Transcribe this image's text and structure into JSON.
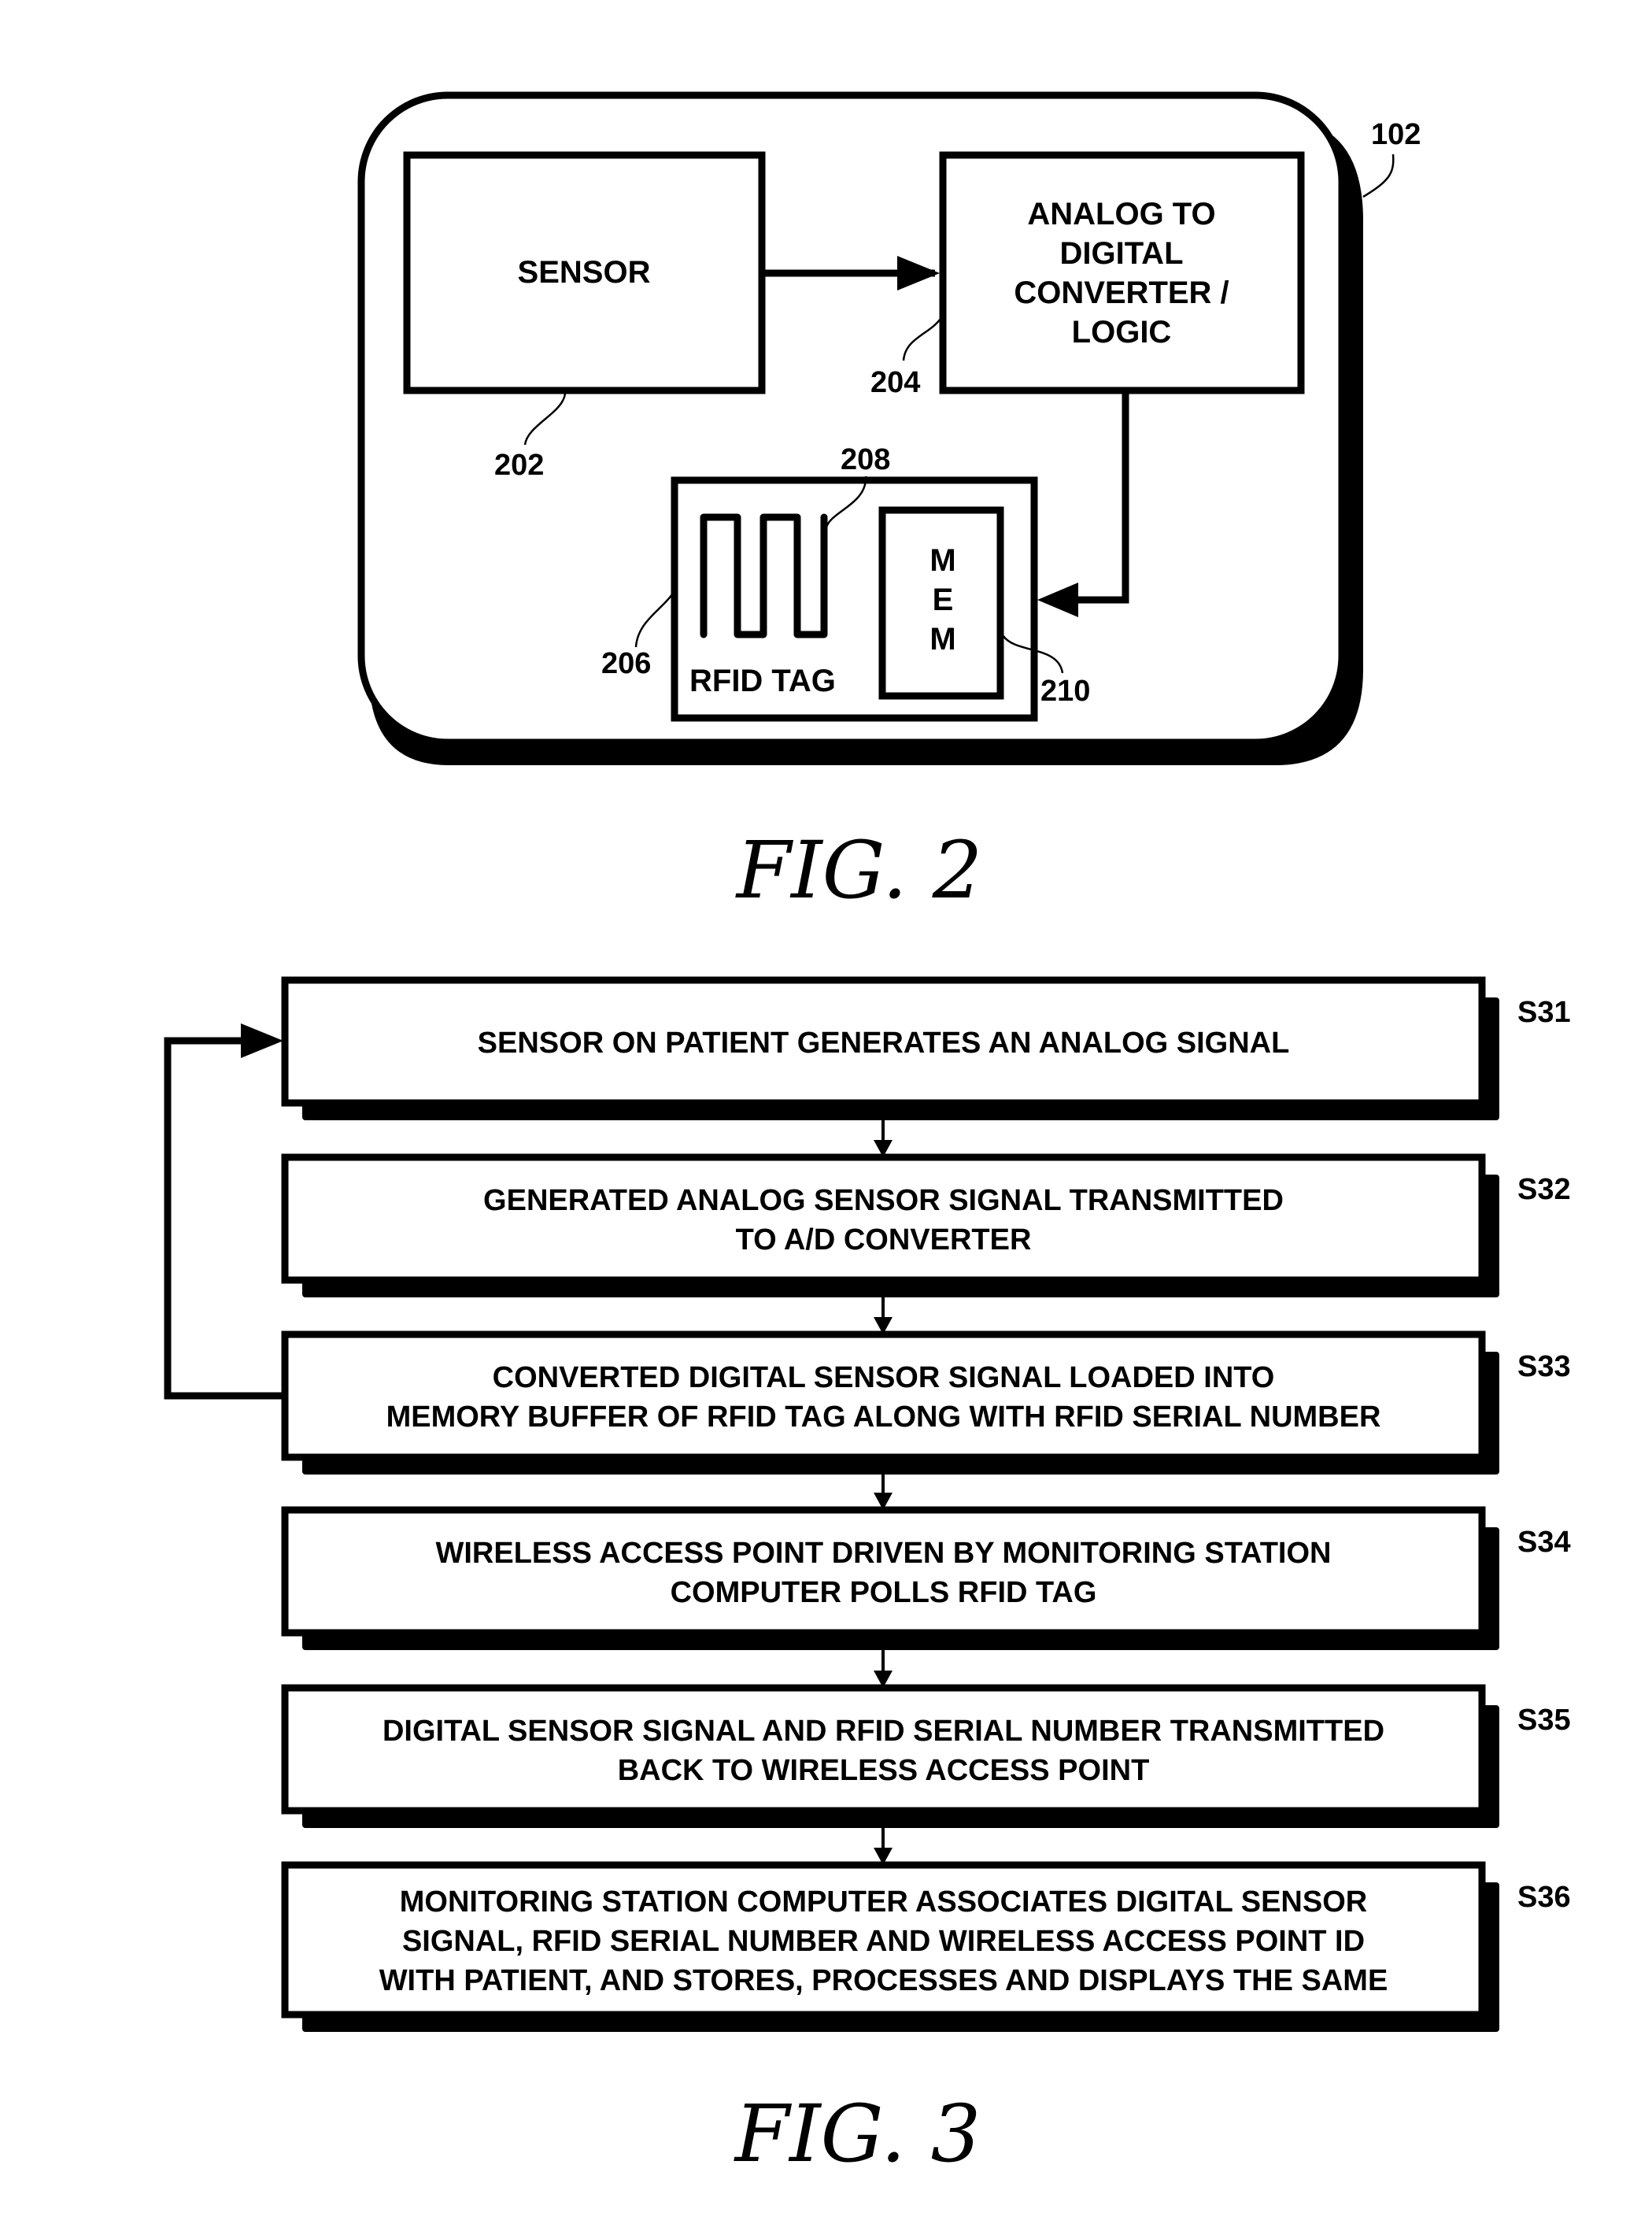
{
  "colors": {
    "ink": "#000000",
    "paper": "#ffffff"
  },
  "fig2": {
    "caption": "FIG. 2",
    "device_ref": "102",
    "sensor": {
      "label": "SENSOR",
      "ref": "202"
    },
    "adc": {
      "lines": [
        "ANALOG TO",
        "DIGITAL",
        "CONVERTER /",
        "LOGIC"
      ],
      "ref": "204"
    },
    "rfid_tag": {
      "label": "RFID TAG",
      "ref": "206"
    },
    "antenna": {
      "ref": "208"
    },
    "memory": {
      "letters": [
        "M",
        "E",
        "M"
      ],
      "ref": "210"
    }
  },
  "fig3": {
    "caption": "FIG. 3",
    "steps": [
      {
        "id": "S31",
        "lines": [
          "SENSOR ON PATIENT GENERATES AN ANALOG SIGNAL"
        ]
      },
      {
        "id": "S32",
        "lines": [
          "GENERATED ANALOG SENSOR SIGNAL TRANSMITTED",
          "TO A/D CONVERTER"
        ]
      },
      {
        "id": "S33",
        "lines": [
          "CONVERTED DIGITAL SENSOR SIGNAL LOADED INTO",
          "MEMORY BUFFER OF RFID TAG ALONG WITH RFID SERIAL NUMBER"
        ]
      },
      {
        "id": "S34",
        "lines": [
          "WIRELESS ACCESS POINT DRIVEN BY MONITORING STATION",
          "COMPUTER POLLS RFID TAG"
        ]
      },
      {
        "id": "S35",
        "lines": [
          "DIGITAL SENSOR SIGNAL AND RFID SERIAL NUMBER TRANSMITTED",
          "BACK TO WIRELESS ACCESS POINT"
        ]
      },
      {
        "id": "S36",
        "lines": [
          "MONITORING STATION COMPUTER ASSOCIATES DIGITAL SENSOR",
          "SIGNAL, RFID SERIAL NUMBER AND WIRELESS ACCESS POINT ID",
          "WITH PATIENT, AND STORES, PROCESSES AND DISPLAYS THE SAME"
        ]
      }
    ],
    "loop": {
      "from": "S33",
      "to": "S31"
    }
  }
}
